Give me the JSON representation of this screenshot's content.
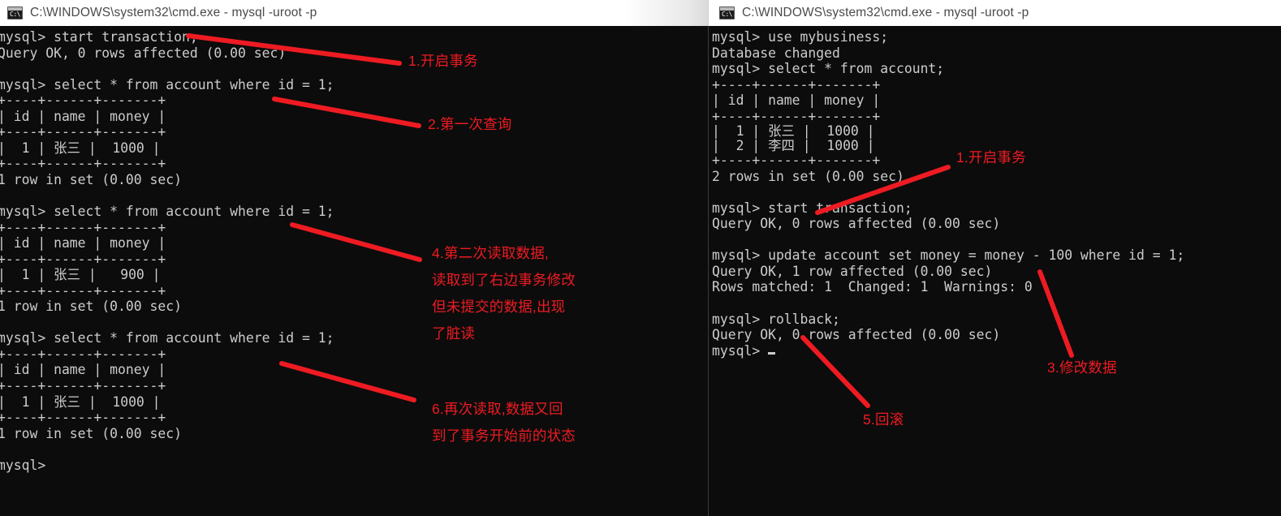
{
  "window_left": {
    "icon": "cmd-icon",
    "icon_glyph": "C:\\.",
    "title": "C:\\WINDOWS\\system32\\cmd.exe - mysql  -uroot -p",
    "console_text": "mysql> start transaction;\nQuery OK, 0 rows affected (0.00 sec)\n\nmysql> select * from account where id = 1;\n+----+------+-------+\n| id | name | money |\n+----+------+-------+\n|  1 | 张三 |  1000 |\n+----+------+-------+\n1 row in set (0.00 sec)\n\nmysql> select * from account where id = 1;\n+----+------+-------+\n| id | name | money |\n+----+------+-------+\n|  1 | 张三 |   900 |\n+----+------+-------+\n1 row in set (0.00 sec)\n\nmysql> select * from account where id = 1;\n+----+------+-------+\n| id | name | money |\n+----+------+-------+\n|  1 | 张三 |  1000 |\n+----+------+-------+\n1 row in set (0.00 sec)\n\nmysql>"
  },
  "window_right": {
    "icon": "cmd-icon",
    "icon_glyph": "C:\\.",
    "title": "C:\\WINDOWS\\system32\\cmd.exe - mysql  -uroot -p",
    "console_head": "mysql> use mybusiness;\nDatabase changed\nmysql> select * from account;\n+----+------+-------+\n| id | name | money |\n+----+------+-------+",
    "console_rows": "|  1 | 张三 |  1000 |\n|  2 | 李四 |  1000 |",
    "console_tail": "+----+------+-------+\n2 rows in set (0.00 sec)\n\nmysql> start transaction;\nQuery OK, 0 rows affected (0.00 sec)\n\nmysql> update account set money = money - 100 where id = 1;\nQuery OK, 1 row affected (0.00 sec)\nRows matched: 1  Changed: 1  Warnings: 0\n\nmysql> rollback;\nQuery OK, 0 rows affected (0.00 sec)\n",
    "console_prompt": "mysql> "
  },
  "annotations": {
    "color": "#ee1b22",
    "left": [
      {
        "id": "a1",
        "text": "1.开启事务"
      },
      {
        "id": "a2",
        "text": "2.第一次查询"
      },
      {
        "id": "a4",
        "text": "4.第二次读取数据,\n读取到了右边事务修改\n但未提交的数据,出现\n了脏读"
      },
      {
        "id": "a6",
        "text": "6.再次读取,数据又回\n到了事务开始前的状态"
      }
    ],
    "right": [
      {
        "id": "b1",
        "text": "1.开启事务"
      },
      {
        "id": "b3",
        "text": "3.修改数据"
      },
      {
        "id": "b5",
        "text": "5.回滚"
      }
    ]
  }
}
